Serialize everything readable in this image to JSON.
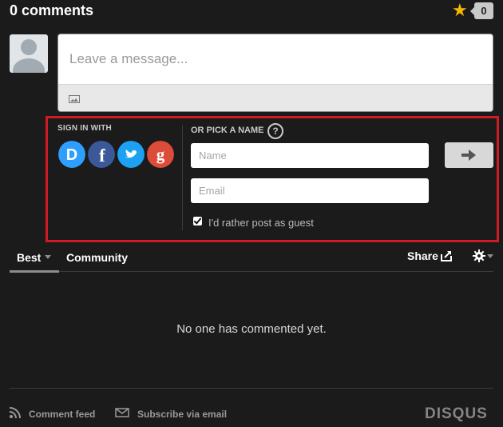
{
  "header": {
    "comment_count_label": "0 comments",
    "star_count": "0"
  },
  "composer": {
    "placeholder": "Leave a message..."
  },
  "auth": {
    "sign_in_label": "SIGN IN WITH",
    "providers": [
      "Disqus",
      "Facebook",
      "Twitter",
      "Google"
    ],
    "pick_name_label": "OR PICK A NAME",
    "name_placeholder": "Name",
    "email_placeholder": "Email",
    "guest_label": "I'd rather post as guest",
    "guest_checked": true
  },
  "tabs": {
    "best_label": "Best",
    "community_label": "Community",
    "share_label": "Share"
  },
  "empty_state": "No one has commented yet.",
  "footer": {
    "comment_feed_label": "Comment feed",
    "subscribe_label": "Subscribe via email",
    "logo": "DISQUS"
  },
  "colors": {
    "accent_border": "#d11a24",
    "star": "#f5b800",
    "disqus": "#2e9fff",
    "facebook": "#3b5998",
    "twitter": "#1da1f2",
    "google": "#dd4b39"
  }
}
